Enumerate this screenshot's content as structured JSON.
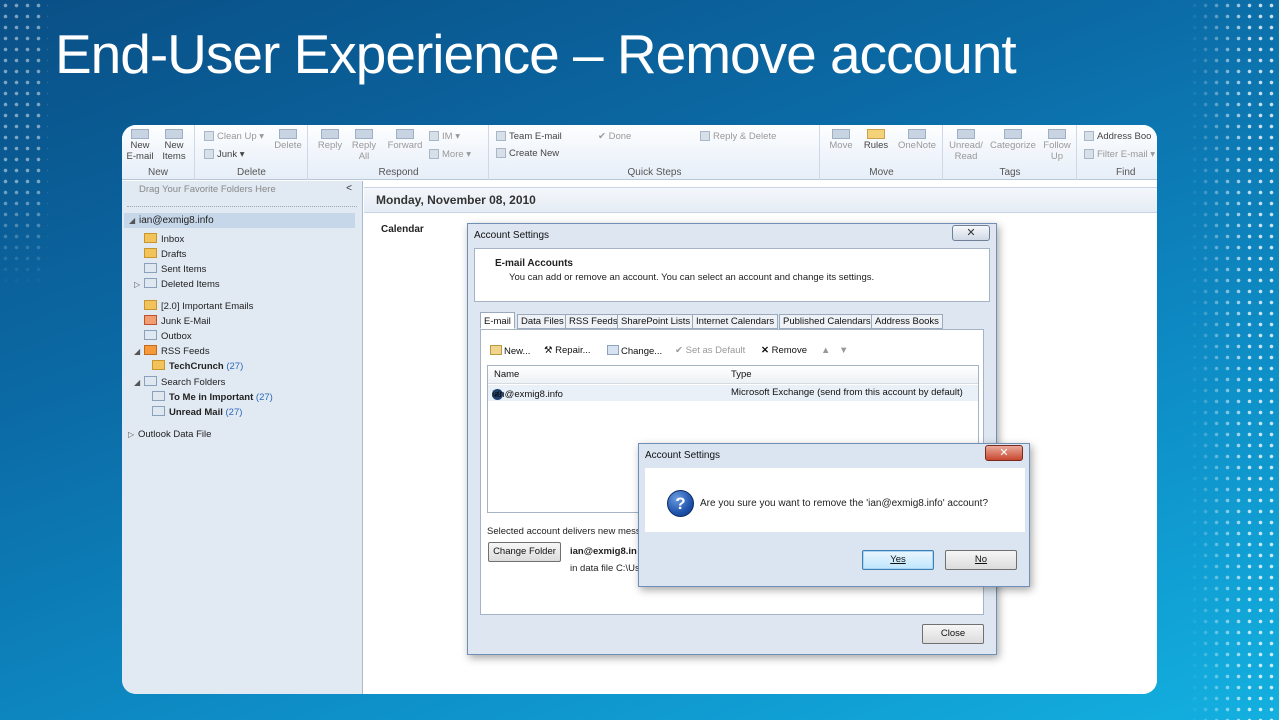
{
  "slide": {
    "title": "End-User Experience – Remove account"
  },
  "ribbon": {
    "new_email": "New\nE-mail",
    "new_items": "New\nItems",
    "group_new": "New",
    "clean_up": "Clean Up",
    "junk": "Junk",
    "delete": "Delete",
    "group_delete": "Delete",
    "reply": "Reply",
    "reply_all": "Reply\nAll",
    "forward": "Forward",
    "im": "IM",
    "more": "More",
    "group_respond": "Respond",
    "team_email": "Team E-mail",
    "create_new": "Create New",
    "done": "Done",
    "reply_delete": "Reply & Delete",
    "group_quicksteps": "Quick Steps",
    "move": "Move",
    "rules": "Rules",
    "onenote": "OneNote",
    "group_move": "Move",
    "unread_read": "Unread/\nRead",
    "categorize": "Categorize",
    "follow_up": "Follow\nUp",
    "group_tags": "Tags",
    "address_book": "Address Boo",
    "filter_email": "Filter E-mail",
    "group_find": "Find"
  },
  "nav": {
    "hint": "Drag Your Favorite Folders Here",
    "collapse": "<",
    "account": "ian@exmig8.info",
    "folders": [
      {
        "label": "Inbox"
      },
      {
        "label": "Drafts"
      },
      {
        "label": "Sent Items"
      },
      {
        "label": "Deleted Items"
      },
      {
        "label": "[2.0] Important Emails"
      },
      {
        "label": "Junk E-Mail"
      },
      {
        "label": "Outbox"
      },
      {
        "label": "RSS Feeds"
      },
      {
        "label": "TechCrunch",
        "count": "(27)"
      },
      {
        "label": "Search Folders"
      },
      {
        "label": "To Me in Important",
        "count": "(27)"
      },
      {
        "label": "Unread Mail",
        "count": "(27)"
      },
      {
        "label": "Outlook Data File"
      }
    ]
  },
  "main": {
    "date_header": "Monday, November 08, 2010",
    "calendar_label": "Calendar"
  },
  "account_settings": {
    "title": "Account Settings",
    "heading": "E-mail Accounts",
    "subtitle": "You can add or remove an account. You can select an account and change its settings.",
    "tabs": [
      "E-mail",
      "Data Files",
      "RSS Feeds",
      "SharePoint Lists",
      "Internet Calendars",
      "Published Calendars",
      "Address Books"
    ],
    "toolbar": {
      "new": "New...",
      "repair": "Repair...",
      "change": "Change...",
      "set_default": "Set as Default",
      "remove": "Remove"
    },
    "columns": {
      "name": "Name",
      "type": "Type"
    },
    "row": {
      "name": "ian@exmig8.info",
      "type": "Microsoft Exchange (send from this account by default)"
    },
    "delivers_text": "Selected account delivers new messa",
    "change_folder": "Change Folder",
    "folder_account": "ian@exmig8.in",
    "data_file_text": "in data file C:\\Us",
    "close": "Close",
    "close_x": "✕"
  },
  "confirm": {
    "title": "Account Settings",
    "message": "Are you sure you want to remove the 'ian@exmig8.info' account?",
    "yes": "Yes",
    "no": "No",
    "close_x": "✕",
    "icon_glyph": "?"
  },
  "colors": {
    "accent": "#0b6aa5",
    "nav_bg": "#e1e9f3",
    "dialog_bg": "#dde6f1"
  }
}
